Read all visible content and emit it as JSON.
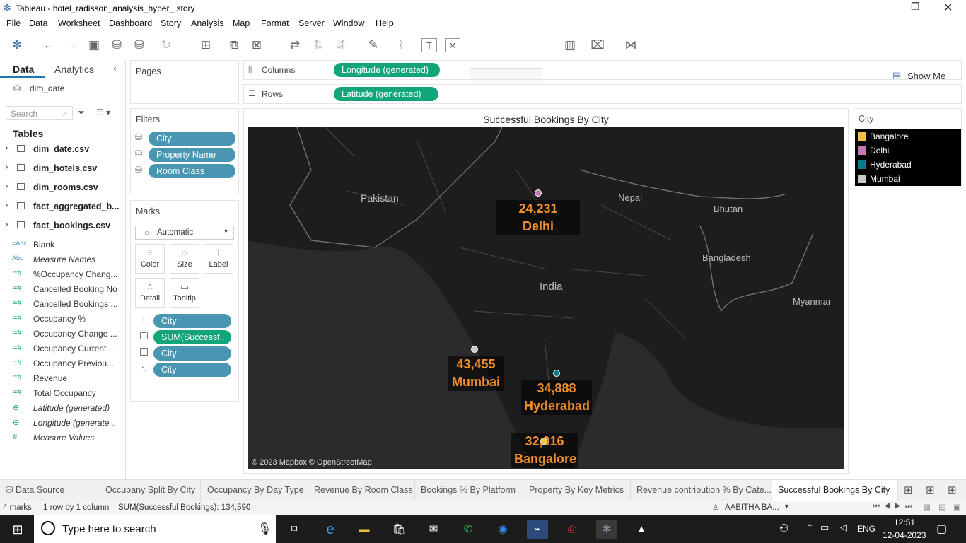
{
  "window": {
    "title": "Tableau - hotel_radisson_analysis_hyper_ story"
  },
  "menu": [
    "File",
    "Data",
    "Worksheet",
    "Dashboard",
    "Story",
    "Analysis",
    "Map",
    "Format",
    "Server",
    "Window",
    "Help"
  ],
  "toolbar": {
    "show_me": "Show Me"
  },
  "data_pane": {
    "tab_data": "Data",
    "tab_analytics": "Analytics",
    "datasource": "dim_date",
    "search_placeholder": "Search",
    "tables_heading": "Tables",
    "tables": [
      "dim_date.csv",
      "dim_hotels.csv",
      "dim_rooms.csv",
      "fact_aggregated_b...",
      "fact_bookings.csv"
    ],
    "fields": [
      {
        "icon": "=Abc",
        "name": "Blank",
        "italic": false
      },
      {
        "icon": "Abc",
        "name": "Measure Names",
        "italic": true
      },
      {
        "icon": "=#",
        "name": "%Occupancy Chang...",
        "italic": false
      },
      {
        "icon": "=#",
        "name": "Cancelled Booking No",
        "italic": false
      },
      {
        "icon": "=#",
        "name": "Cancelled Bookings ...",
        "italic": false
      },
      {
        "icon": "=#",
        "name": "Occupancy %",
        "italic": false
      },
      {
        "icon": "=#",
        "name": "Occupancy Change ...",
        "italic": false
      },
      {
        "icon": "=#",
        "name": "Occupancy Current ...",
        "italic": false
      },
      {
        "icon": "=#",
        "name": "Occupancy Previou...",
        "italic": false
      },
      {
        "icon": "=#",
        "name": "Revenue",
        "italic": false
      },
      {
        "icon": "=#",
        "name": "Total Occupancy",
        "italic": false
      },
      {
        "icon": "globe",
        "name": "Latitude (generated)",
        "italic": true
      },
      {
        "icon": "globe",
        "name": "Longitude (generate...",
        "italic": true
      },
      {
        "icon": "#",
        "name": "Measure Values",
        "italic": true
      }
    ]
  },
  "pages": {
    "label": "Pages"
  },
  "filters": {
    "label": "Filters",
    "items": [
      "City",
      "Property Name",
      "Room Class"
    ]
  },
  "marks": {
    "label": "Marks",
    "type": "Automatic",
    "buttons": [
      "Color",
      "Size",
      "Label",
      "Detail",
      "Tooltip"
    ],
    "pills": [
      {
        "icon": "color",
        "text": "City"
      },
      {
        "icon": "label",
        "text": "SUM(Successf.."
      },
      {
        "icon": "label",
        "text": "City"
      },
      {
        "icon": "detail",
        "text": "City"
      }
    ]
  },
  "shelves": {
    "columns_label": "Columns",
    "columns_pill": "Longitude (generated)",
    "rows_label": "Rows",
    "rows_pill": "Latitude (generated)"
  },
  "viz": {
    "title": "Successful Bookings By City",
    "attribution": "© 2023 Mapbox © OpenStreetMap",
    "map_labels": [
      "Pakistan",
      "Nepal",
      "Bhutan",
      "India",
      "Bangladesh",
      "Myanmar"
    ],
    "points": [
      {
        "city": "Delhi",
        "value": "24,231",
        "color": "#c27ab0"
      },
      {
        "city": "Mumbai",
        "value": "43,455",
        "color": "#c9c9c9"
      },
      {
        "city": "Hyderabad",
        "value": "34,888",
        "color": "#0b7b8c"
      },
      {
        "city": "Bangalore",
        "value": "32,016",
        "color": "#f2c23a"
      }
    ]
  },
  "chart_data": {
    "type": "scatter",
    "title": "Successful Bookings By City",
    "xlabel": "",
    "ylabel": "",
    "categories": [
      "Delhi",
      "Mumbai",
      "Hyderabad",
      "Bangalore"
    ],
    "values": [
      24231,
      43455,
      34888,
      32016
    ]
  },
  "legend": {
    "title": "City",
    "items": [
      {
        "name": "Bangalore",
        "color": "#f2c23a"
      },
      {
        "name": "Delhi",
        "color": "#c27ab0"
      },
      {
        "name": "Hyderabad",
        "color": "#0b7b8c"
      },
      {
        "name": "Mumbai",
        "color": "#c9c9c9"
      }
    ]
  },
  "tabs": {
    "data_source": "Data Source",
    "sheets": [
      "Occupany Split By City",
      "Occupancy By Day Type",
      "Revenue By Room Class",
      "Bookings % By Platform",
      "Property By Key Metrics",
      "Revenue contribution % By Cate...",
      "Successful Bookings By City"
    ]
  },
  "status": {
    "marks": "4 marks",
    "rows": "1 row by 1 column",
    "sum": "SUM(Successful Bookings): 134,590",
    "user": "AABITHA BA..."
  },
  "taskbar": {
    "search_placeholder": "Type here to search",
    "lang": "ENG",
    "time": "12:51",
    "date": "12-04-2023"
  }
}
